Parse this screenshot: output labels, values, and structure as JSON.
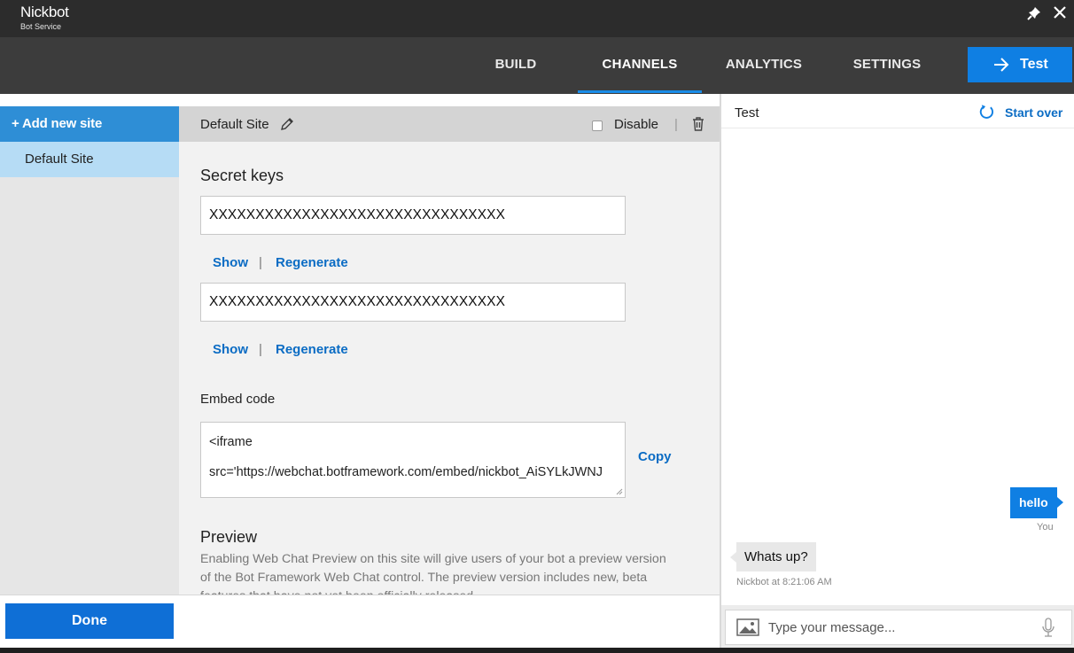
{
  "app": {
    "title": "Nickbot",
    "subtitle": "Bot Service"
  },
  "nav": {
    "tabs": [
      {
        "label": "BUILD",
        "active": false
      },
      {
        "label": "CHANNELS",
        "active": true
      },
      {
        "label": "ANALYTICS",
        "active": false
      },
      {
        "label": "SETTINGS",
        "active": false
      }
    ],
    "test_button": "Test"
  },
  "sidebar": {
    "add_label": "+ Add new site",
    "sites": [
      "Default Site"
    ]
  },
  "site": {
    "title": "Default Site",
    "disable_label": "Disable",
    "disabled": false,
    "secret_keys_title": "Secret keys",
    "keys": [
      {
        "value": "XXXXXXXXXXXXXXXXXXXXXXXXXXXXXXXX",
        "show": "Show",
        "regenerate": "Regenerate"
      },
      {
        "value": "XXXXXXXXXXXXXXXXXXXXXXXXXXXXXXXX",
        "show": "Show",
        "regenerate": "Regenerate"
      }
    ],
    "embed_title": "Embed code",
    "embed_line1": "<iframe",
    "embed_line2": "src='https://webchat.botframework.com/embed/nickbot_AiSYLkJWNJ",
    "copy_label": "Copy",
    "preview_title": "Preview",
    "preview_text": "Enabling Web Chat Preview on this site will give users of your bot a preview version of the Bot Framework Web Chat control. The preview version includes new, beta features that have not yet been officially released."
  },
  "footer": {
    "done_label": "Done"
  },
  "test_panel": {
    "title": "Test",
    "start_over": "Start over",
    "messages": [
      {
        "text": "hello",
        "meta": "You",
        "from": "user"
      },
      {
        "text": "Whats up?",
        "meta": "Nickbot at 8:21:06 AM",
        "from": "bot"
      }
    ],
    "input_placeholder": "Type your message..."
  },
  "colors": {
    "accent": "#0f7fe3",
    "link": "#0b6cc4",
    "sidebar_active": "#2e8ed6",
    "site_selected": "#b6dcf5"
  }
}
